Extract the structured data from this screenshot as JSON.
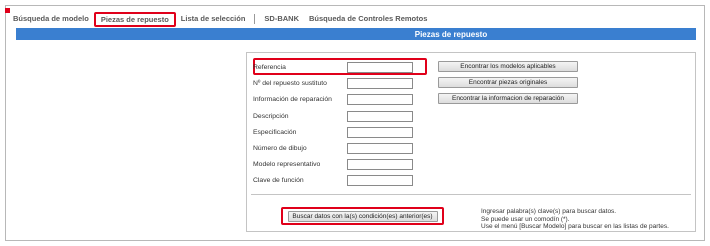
{
  "tabs": [
    {
      "label": "Búsqueda de modelo",
      "active": false,
      "highlighted": false
    },
    {
      "label": "Piezas de repuesto",
      "active": true,
      "highlighted": true
    },
    {
      "label": "Lista de selección",
      "active": false,
      "highlighted": false
    },
    {
      "label": "SD-BANK",
      "active": false,
      "highlighted": false
    },
    {
      "label": "Búsqueda de Controles Remotos",
      "active": false,
      "highlighted": false
    }
  ],
  "header": {
    "title": "Piezas de repuesto"
  },
  "form": {
    "fields": [
      {
        "label": "Referencia",
        "value": ""
      },
      {
        "label": "Nº del repuesto sustituto",
        "value": ""
      },
      {
        "label": "Información de reparación",
        "value": ""
      },
      {
        "label": "Descripción",
        "value": ""
      },
      {
        "label": "Especificación",
        "value": ""
      },
      {
        "label": "Número de dibujo",
        "value": ""
      },
      {
        "label": "Modelo representativo",
        "value": ""
      },
      {
        "label": "Clave de función",
        "value": ""
      }
    ],
    "buttons": {
      "find_models": "Encontrar los modelos aplicables",
      "find_original": "Encontrar piezas originales",
      "find_repair": "Encontrar la informacion de reparación"
    },
    "search_button": "Buscar datos con la(s) condición(es) anterior(es)",
    "help": [
      "Ingresar palabra(s) clave(s) para buscar datos.",
      "Se puede usar un comodín (*).",
      "Use el menú [Buscar Modelo] para buscar en las listas de partes."
    ]
  },
  "colors": {
    "accent": "#3a7fd0",
    "highlight": "#e0001a"
  }
}
